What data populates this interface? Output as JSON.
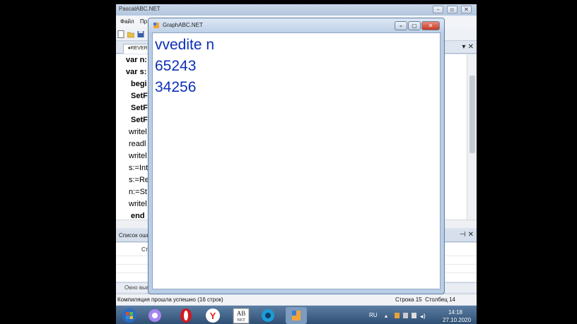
{
  "ide": {
    "title": "PascalABC.NET",
    "menu": [
      "Файл",
      "Пр"
    ],
    "tab": "♦REVER",
    "code_lines": [
      "var n:",
      "var s:",
      "begi",
      "SetF",
      "SetF",
      "SetF",
      "writel",
      "readl",
      "writel",
      "s:=Int",
      "s:=Re",
      "n:=St",
      "writel",
      "end"
    ],
    "errors_title": "Список оши",
    "errors_column": "Ст",
    "output_tab": "Окно выв",
    "status_message": "Компиляция прошла успешно (16 строк)",
    "status_line": "Строка 15",
    "status_col": "Столбец 14"
  },
  "graph": {
    "title": "GraphABC.NET",
    "output": [
      "vvedite n",
      "65243",
      "34256"
    ],
    "text_color": "#0b2fb8"
  },
  "taskbar": {
    "lang": "RU",
    "time": "14:18",
    "date": "27.10.2020"
  }
}
